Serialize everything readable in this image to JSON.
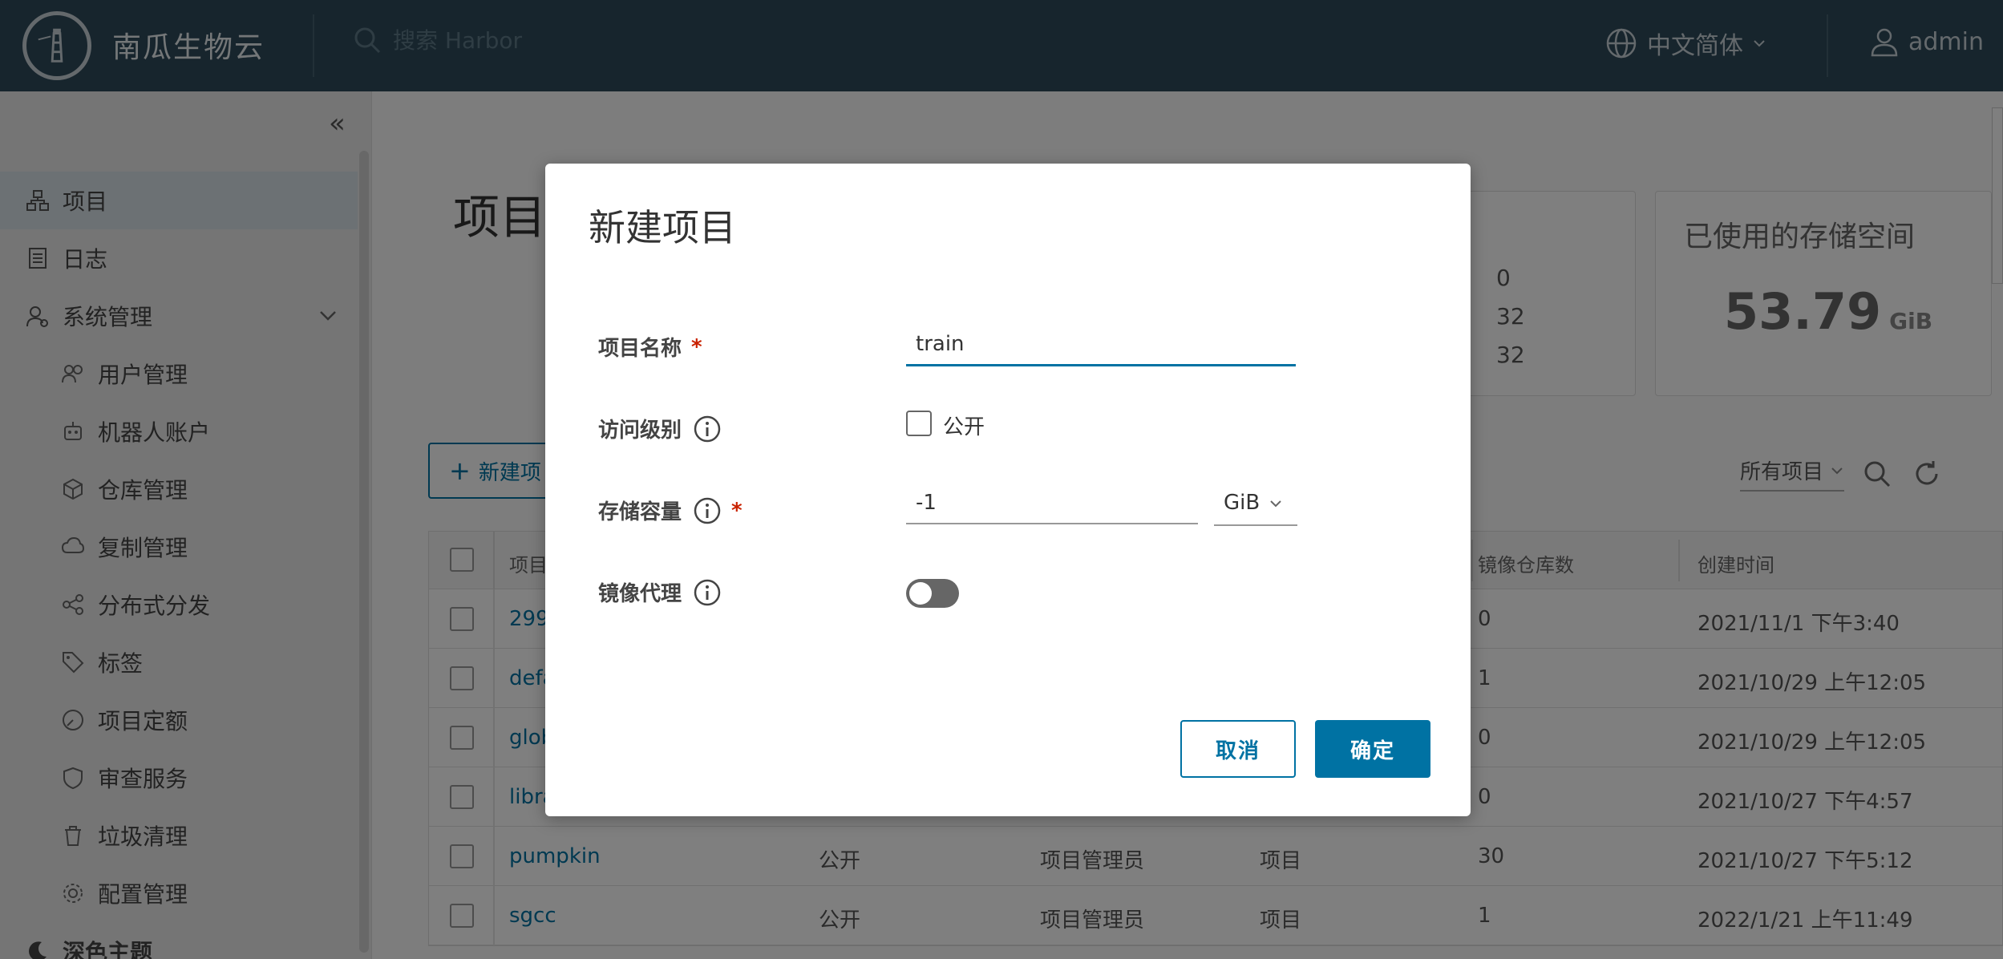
{
  "header": {
    "brand": "南瓜生物云",
    "search_placeholder": "搜索 Harbor",
    "language": "中文简体",
    "user": "admin"
  },
  "sidebar": {
    "items": [
      {
        "label": "项目",
        "icon": "projects-icon",
        "active": true
      },
      {
        "label": "日志",
        "icon": "logs-icon"
      },
      {
        "label": "系统管理",
        "icon": "admin-icon"
      },
      {
        "label": "用户管理",
        "icon": "users-icon"
      },
      {
        "label": "机器人账户",
        "icon": "robot-icon"
      },
      {
        "label": "仓库管理",
        "icon": "registry-icon"
      },
      {
        "label": "复制管理",
        "icon": "replication-icon"
      },
      {
        "label": "分布式分发",
        "icon": "distribution-icon"
      },
      {
        "label": "标签",
        "icon": "tag-icon"
      },
      {
        "label": "项目定额",
        "icon": "quota-icon"
      },
      {
        "label": "审查服务",
        "icon": "shield-icon"
      },
      {
        "label": "垃圾清理",
        "icon": "trash-icon"
      },
      {
        "label": "配置管理",
        "icon": "gear-icon"
      },
      {
        "label": "深色主题",
        "icon": "moon-icon"
      }
    ]
  },
  "main": {
    "title": "项目",
    "stats": [
      "0",
      "32",
      "32"
    ],
    "storage_title": "已使用的存储空间",
    "storage_value": "53.79",
    "storage_unit": "GiB",
    "new_project_button": "新建项",
    "filter_label": "所有项目",
    "table": {
      "headers": [
        "项目",
        "镜像仓库数",
        "创建时间"
      ],
      "rows": [
        {
          "name": "299",
          "access": "",
          "role": "",
          "type": "",
          "repos": "0",
          "created": "2021/11/1 下午3:40"
        },
        {
          "name": "defa",
          "access": "",
          "role": "",
          "type": "",
          "repos": "1",
          "created": "2021/10/29 上午12:05"
        },
        {
          "name": "glob",
          "access": "",
          "role": "",
          "type": "",
          "repos": "0",
          "created": "2021/10/29 上午12:05"
        },
        {
          "name": "libra",
          "access": "",
          "role": "",
          "type": "",
          "repos": "0",
          "created": "2021/10/27 下午4:57"
        },
        {
          "name": "pumpkin",
          "access": "公开",
          "role": "项目管理员",
          "type": "项目",
          "repos": "30",
          "created": "2021/10/27 下午5:12"
        },
        {
          "name": "sgcc",
          "access": "公开",
          "role": "项目管理员",
          "type": "项目",
          "repos": "1",
          "created": "2022/1/21 上午11:49"
        }
      ]
    }
  },
  "modal": {
    "title": "新建项目",
    "name_label": "项目名称",
    "name_value": "train",
    "access_label": "访问级别",
    "public_label": "公开",
    "public_checked": false,
    "storage_label": "存储容量",
    "storage_value": "-1",
    "storage_unit": "GiB",
    "proxy_label": "镜像代理",
    "proxy_enabled": false,
    "required_mark": "*",
    "cancel": "取消",
    "ok": "确定"
  },
  "colors": {
    "header_bg": "#2e4a5b",
    "primary": "#0072a3",
    "required": "#c92100"
  }
}
